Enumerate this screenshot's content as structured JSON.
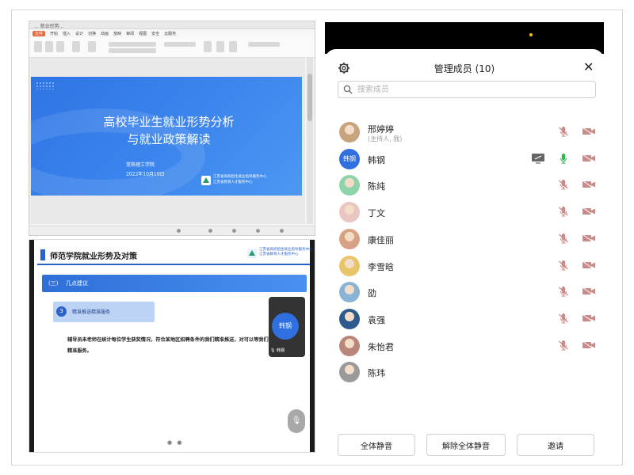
{
  "wps": {
    "window_title": "... 就业形势...",
    "menu": [
      "文件",
      "开始",
      "插入",
      "设计",
      "切换",
      "动画",
      "放映",
      "审阅",
      "视图",
      "安全",
      "云服务"
    ],
    "slide": {
      "title_line1": "高校毕业生就业形势分析",
      "title_line2": "与就业政策解读",
      "org": "常熟理工学院",
      "date": "2022年10月10日",
      "logo_text_1": "江苏省高校招生就业指导服务中心",
      "logo_text_2": "江苏省教育人才服务中心"
    }
  },
  "share": {
    "title": "师范学院就业形势及对策",
    "logo_text_1": "江苏省高校招生就业指导服务中心",
    "logo_text_2": "江苏省教育人才服务中心",
    "section_num": "(三)",
    "section_label": "几点建议",
    "sub_num": "3",
    "sub_label": "精准推送精准服务",
    "body": "辅导员未老师在统计每位学生获奖情况，符合某地区招聘条件的我们精准推送，对可以等我们精准服务。",
    "speaker_name": "韩钢",
    "speaker_status": "韩钢",
    "page_dots": "● ●"
  },
  "panel": {
    "title": "管理成员 (10)",
    "search_placeholder": "搜索成员",
    "members": [
      {
        "name": "邢婷婷",
        "sub": "(主持人, 我)",
        "avatar": "photo",
        "avatar_color": "#c9a27e",
        "mic": "muted",
        "sharing": false
      },
      {
        "name": "韩钢",
        "sub": "",
        "avatar": "text",
        "avatar_text": "韩钢",
        "avatar_color": "#2f6fe0",
        "mic": "active",
        "sharing": true
      },
      {
        "name": "陈纯",
        "sub": "",
        "avatar": "photo",
        "avatar_color": "#8fd3a8",
        "mic": "muted",
        "sharing": false
      },
      {
        "name": "丁文",
        "sub": "",
        "avatar": "photo",
        "avatar_color": "#e9c7c0",
        "mic": "muted",
        "sharing": false
      },
      {
        "name": "康佳丽",
        "sub": "",
        "avatar": "photo",
        "avatar_color": "#d9a184",
        "mic": "muted",
        "sharing": false
      },
      {
        "name": "李雪晗",
        "sub": "",
        "avatar": "photo",
        "avatar_color": "#e8c46a",
        "mic": "muted",
        "sharing": false
      },
      {
        "name": "劭",
        "sub": "",
        "avatar": "photo",
        "avatar_color": "#8ab4d6",
        "mic": "muted",
        "sharing": false
      },
      {
        "name": "袁强",
        "sub": "",
        "avatar": "photo",
        "avatar_color": "#2d5a8c",
        "mic": "muted",
        "sharing": false
      },
      {
        "name": "朱怡君",
        "sub": "",
        "avatar": "photo",
        "avatar_color": "#b8867a",
        "mic": "muted",
        "sharing": false
      },
      {
        "name": "陈玮",
        "sub": "",
        "avatar": "photo",
        "avatar_color": "#9a9a9a",
        "mic": "none",
        "sharing": false
      }
    ],
    "buttons": {
      "mute_all": "全体静音",
      "unmute_all": "解除全体静音",
      "invite": "邀请"
    }
  },
  "colors": {
    "accent_blue": "#2f6fe0",
    "mic_active": "#2db84d",
    "muted_icon": "#c98a8a"
  }
}
